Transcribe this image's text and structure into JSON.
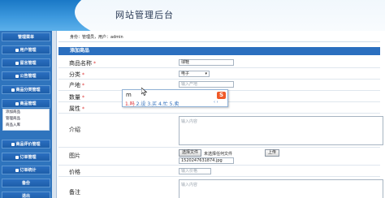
{
  "header": {
    "title": "网站管理后台"
  },
  "sidebar": {
    "items": [
      {
        "label": "管理菜单"
      },
      {
        "label": "用户管理"
      },
      {
        "label": "留言管理"
      },
      {
        "label": "公告管理"
      },
      {
        "label": "商品分类管理"
      },
      {
        "label": "商品管理"
      },
      {
        "label": "商品评价管理"
      },
      {
        "label": "订单管理"
      },
      {
        "label": "订单统计"
      },
      {
        "label": "备份"
      },
      {
        "label": "退出"
      }
    ],
    "submenu": [
      "添加商品",
      "管理商品",
      "商品入库"
    ]
  },
  "breadcrumb": "身份：管理员，用户：admin",
  "panel": {
    "title": "添加商品"
  },
  "form": {
    "name": {
      "label": "商品名称",
      "value": "球鞋",
      "required": "*"
    },
    "category": {
      "label": "分类",
      "value": "电子",
      "required": "*"
    },
    "origin": {
      "label": "产地",
      "placeholder": "输入产地",
      "required": "*"
    },
    "qty": {
      "label": "数量",
      "required": "*"
    },
    "attr": {
      "label": "属性",
      "required": "*"
    },
    "intro": {
      "label": "介绍",
      "placeholder": "输入内容"
    },
    "image": {
      "label": "图片",
      "choose_label": "选择文件",
      "no_file": "未选择任何文件",
      "upload_label": "上传",
      "filename": "1520247631874.jpg"
    },
    "price": {
      "label": "价格",
      "placeholder": "输入价格"
    },
    "note": {
      "label": "备注",
      "placeholder": "输入内容"
    }
  },
  "ime": {
    "composition": "m",
    "candidates": [
      "1.吗",
      "2.设",
      "3.买",
      "4.忙",
      "5.卖"
    ],
    "nav": "‹ ›"
  }
}
